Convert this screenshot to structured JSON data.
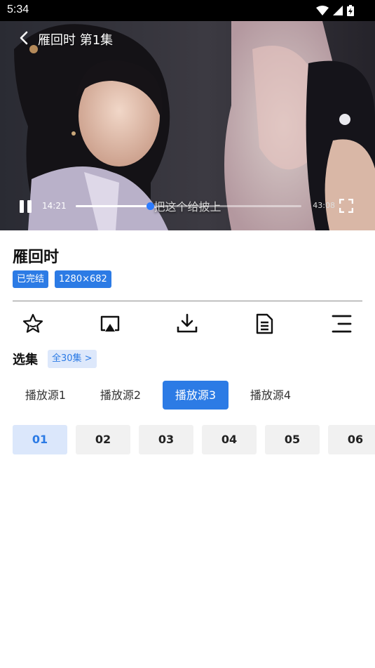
{
  "status_bar": {
    "time": "5:34",
    "icons": [
      "wifi-icon",
      "signal-icon",
      "battery-charging-icon"
    ]
  },
  "player": {
    "title": "雁回时 第1集",
    "subtitle": "把这个给披上",
    "current_time": "14:21",
    "total_time": "43:08",
    "progress": 0.33,
    "state": "playing",
    "accent": "#2c7bff"
  },
  "show": {
    "title": "雁回时",
    "tags": [
      "已完结",
      "1280×682"
    ]
  },
  "actions": [
    "star-icon",
    "cast-icon",
    "download-icon",
    "document-icon",
    "menu-icon"
  ],
  "episodes_section": {
    "label": "选集",
    "all_label": "全30集 >",
    "sources": [
      "播放源1",
      "播放源2",
      "播放源3",
      "播放源4"
    ],
    "active_source": 2,
    "episodes": [
      "01",
      "02",
      "03",
      "04",
      "05",
      "06"
    ],
    "active_episode": 0
  },
  "colors": {
    "accent": "#2c7be5",
    "tag_light": "#dde8fb"
  }
}
